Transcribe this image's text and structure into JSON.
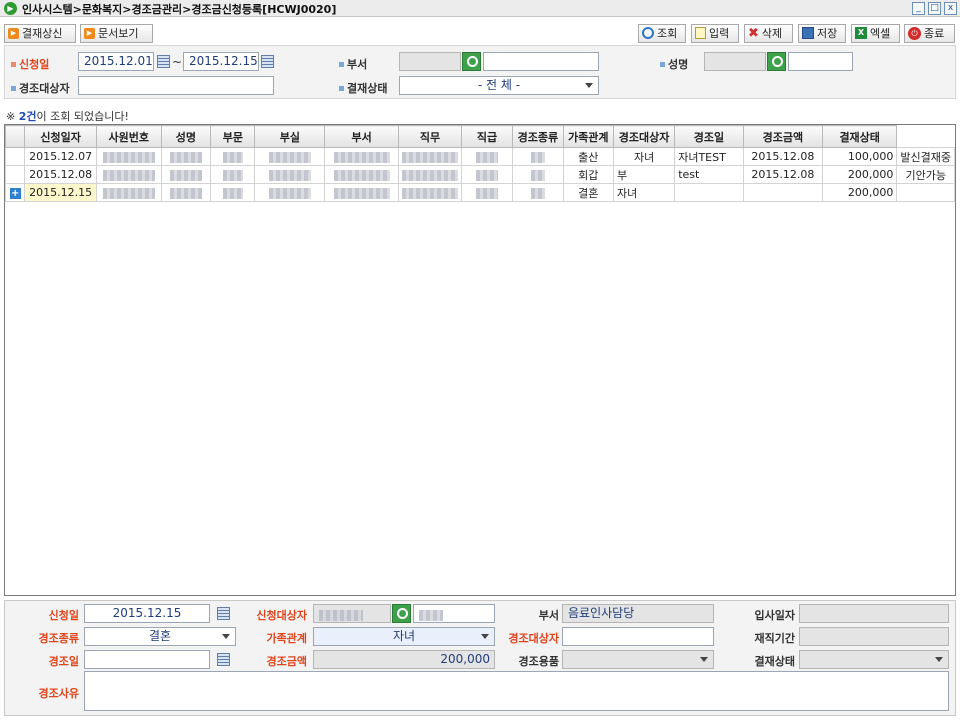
{
  "window": {
    "title": "인사시스템>문화복지>경조금관리>경조금신청등록[HCWJ0020]",
    "min_label": "_",
    "max_label": "□",
    "close_label": "x"
  },
  "toolbar": {
    "approve_label": "결재상신",
    "docview_label": "문서보기",
    "search_label": "조회",
    "input_label": "입력",
    "delete_label": "삭제",
    "save_label": "저장",
    "excel_label": "엑셀",
    "exit_label": "종료"
  },
  "search": {
    "date_label": "신청일",
    "date_from": "2015.12.01",
    "date_sep": "~",
    "date_to": "2015.12.15",
    "dept_label": "부서",
    "name_label": "성명",
    "target_label": "경조대상자",
    "status_label": "결재상태",
    "status_value": "- 전 체 -"
  },
  "result": {
    "prefix": "※ ",
    "count": "2건",
    "suffix": "이 조회 되었습니다!"
  },
  "grid": {
    "columns": [
      "신청일자",
      "사원번호",
      "성명",
      "부문",
      "부실",
      "부서",
      "직무",
      "직급",
      "경조종류",
      "가족관계",
      "경조대상자",
      "경조일",
      "경조금액",
      "결재상태"
    ],
    "rows": [
      {
        "date": "2015.12.07",
        "type": "출산",
        "relation": "자녀",
        "target": "자녀TEST",
        "event_date": "2015.12.08",
        "amount": "100,000",
        "status": "발신결재중"
      },
      {
        "date": "2015.12.08",
        "type": "회갑",
        "relation": "부",
        "target": "test",
        "event_date": "2015.12.08",
        "amount": "200,000",
        "status": "기안가능"
      },
      {
        "date": "2015.12.15",
        "type": "결혼",
        "relation": "자녀",
        "target": "",
        "event_date": "",
        "amount": "200,000",
        "status": ""
      }
    ]
  },
  "detail": {
    "apply_date_label": "신청일",
    "apply_date": "2015.12.15",
    "applicant_label": "신청대상자",
    "dept_label": "부서",
    "dept_value": "음료인사담당",
    "join_label": "입사일자",
    "type_label": "경조종류",
    "type_value": "결혼",
    "relation_label": "가족관계",
    "relation_value": "자녀",
    "target_label": "경조대상자",
    "tenure_label": "재직기간",
    "event_date_label": "경조일",
    "amount_label": "경조금액",
    "amount_value": "200,000",
    "goods_label": "경조용품",
    "status_label": "결재상태",
    "reason_label": "경조사유"
  }
}
